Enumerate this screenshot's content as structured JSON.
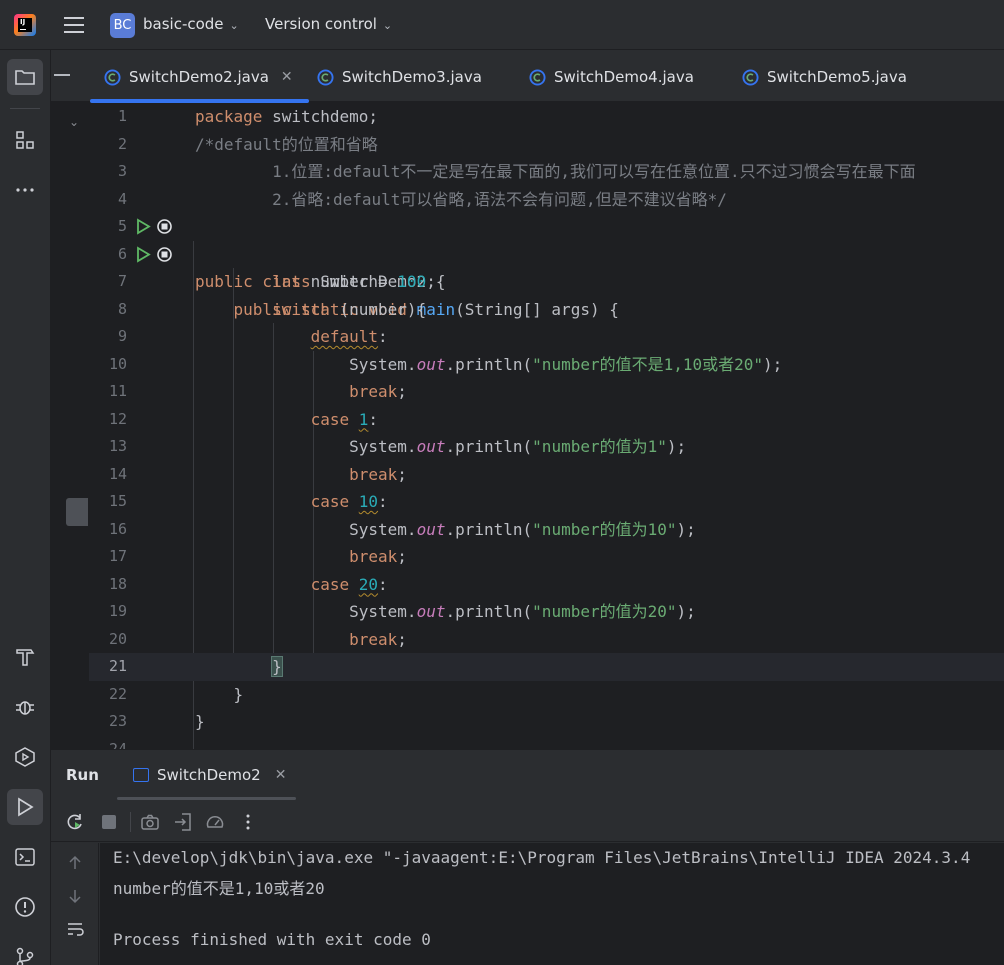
{
  "titlebar": {
    "project_badge": "BC",
    "project_name": "basic-code",
    "vcs_label": "Version control"
  },
  "tabs": [
    {
      "label": "SwitchDemo2.java",
      "active": true,
      "closable": true
    },
    {
      "label": "SwitchDemo3.java",
      "active": false
    },
    {
      "label": "SwitchDemo4.java",
      "active": false
    },
    {
      "label": "SwitchDemo5.java",
      "active": false
    }
  ],
  "editor": {
    "current_line": 21,
    "lines": [
      {
        "n": "1",
        "text": "package switchdemo;"
      },
      {
        "n": "2",
        "text": "/*default的位置和省略"
      },
      {
        "n": "3",
        "text": "        1.位置:default不一定是写在最下面的,我们可以写在任意位置.只不过习惯会写在最下面"
      },
      {
        "n": "4",
        "text": "        2.省略:default可以省略,语法不会有问题,但是不建议省略*/"
      },
      {
        "n": "5",
        "text": "public class SwitchDemo2 {"
      },
      {
        "n": "6",
        "text": "    public static void main(String[] args) {"
      },
      {
        "n": "7",
        "text": "        int number = 100;"
      },
      {
        "n": "8",
        "text": "        switch (number){"
      },
      {
        "n": "9",
        "text": "            default:"
      },
      {
        "n": "10",
        "text": "                System.out.println(\"number的值不是1,10或者20\");"
      },
      {
        "n": "11",
        "text": "                break;"
      },
      {
        "n": "12",
        "text": "            case 1:"
      },
      {
        "n": "13",
        "text": "                System.out.println(\"number的值为1\");"
      },
      {
        "n": "14",
        "text": "                break;"
      },
      {
        "n": "15",
        "text": "            case 10:"
      },
      {
        "n": "16",
        "text": "                System.out.println(\"number的值为10\");"
      },
      {
        "n": "17",
        "text": "                break;"
      },
      {
        "n": "18",
        "text": "            case 20:"
      },
      {
        "n": "19",
        "text": "                System.out.println(\"number的值为20\");"
      },
      {
        "n": "20",
        "text": "                break;"
      },
      {
        "n": "21",
        "text": "        }"
      },
      {
        "n": "22",
        "text": "    }"
      },
      {
        "n": "23",
        "text": "}"
      },
      {
        "n": "24",
        "text": ""
      }
    ]
  },
  "run": {
    "title": "Run",
    "tab_label": "SwitchDemo2",
    "console": [
      "E:\\develop\\jdk\\bin\\java.exe \"-javaagent:E:\\Program Files\\JetBrains\\IntelliJ IDEA 2024.3.4",
      "number的值不是1,10或者20",
      "",
      "Process finished with exit code 0"
    ]
  },
  "colors": {
    "accent": "#3574f0",
    "keyword": "#cf8e6d",
    "string": "#6aab73",
    "number": "#2aacb8",
    "comment": "#7a7e85",
    "run_icon": "#5fb865"
  },
  "icons": [
    "hamburger-icon",
    "chevron-down-icon",
    "folder-icon",
    "structure-icon",
    "more-icon",
    "build-icon",
    "debug-icon",
    "services-icon",
    "run-icon",
    "terminal-icon",
    "problems-icon",
    "git-icon",
    "rerun-icon",
    "stop-icon",
    "camera-icon",
    "import-icon",
    "coverage-icon",
    "kebab-icon",
    "arrow-up-icon",
    "arrow-down-icon",
    "soft-wrap-icon"
  ]
}
